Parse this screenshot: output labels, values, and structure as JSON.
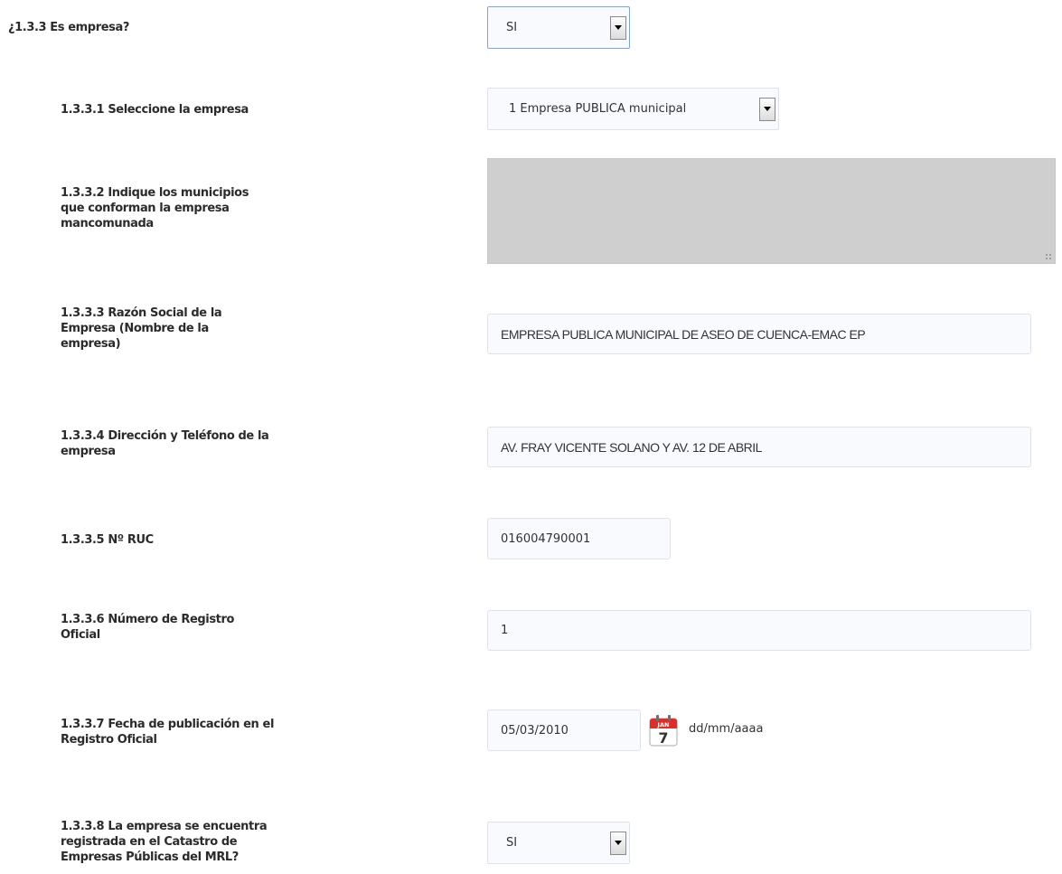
{
  "q133": {
    "label": "¿1.3.3 Es empresa?",
    "value": "SI"
  },
  "q1331": {
    "label": "1.3.3.1 Seleccione la empresa",
    "value": "1 Empresa PUBLICA municipal"
  },
  "q1332": {
    "label_lines": [
      "1.3.3.2 Indique los municipios",
      "que conforman la empresa",
      "mancomunada"
    ],
    "value": ""
  },
  "q1333": {
    "label_lines": [
      "1.3.3.3 Razón Social de la",
      "Empresa (Nombre de la",
      "empresa)"
    ],
    "value": "EMPRESA PUBLICA MUNICIPAL DE ASEO DE CUENCA-EMAC EP"
  },
  "q1334": {
    "label_lines": [
      "1.3.3.4 Dirección y Teléfono de la",
      "empresa"
    ],
    "value": "AV. FRAY VICENTE SOLANO Y AV. 12 DE ABRIL"
  },
  "q1335": {
    "label": "1.3.3.5 Nº RUC",
    "value": "016004790001"
  },
  "q1336": {
    "label_lines": [
      "1.3.3.6 Número de Registro",
      "Oficial"
    ],
    "value": "1"
  },
  "q1337": {
    "label_lines": [
      "1.3.3.7 Fecha de publicación en el",
      "Registro Oficial"
    ],
    "value": "05/03/2010",
    "format_hint": "dd/mm/aaaa",
    "calendar_icon": "calendar-icon",
    "calendar_month": "JAN",
    "calendar_day": "7"
  },
  "q1338": {
    "label_lines": [
      "1.3.3.8 La empresa se encuentra",
      "registrada en el Catastro de",
      "Empresas Públicas del MRL?"
    ],
    "value": "SI"
  },
  "colors": {
    "field_bg": "#f8fafd",
    "field_border": "#dde3ea",
    "disabled_bg": "#cfcfcf",
    "focus_border": "#7aa7d8",
    "calendar_red": "#d9302b"
  }
}
